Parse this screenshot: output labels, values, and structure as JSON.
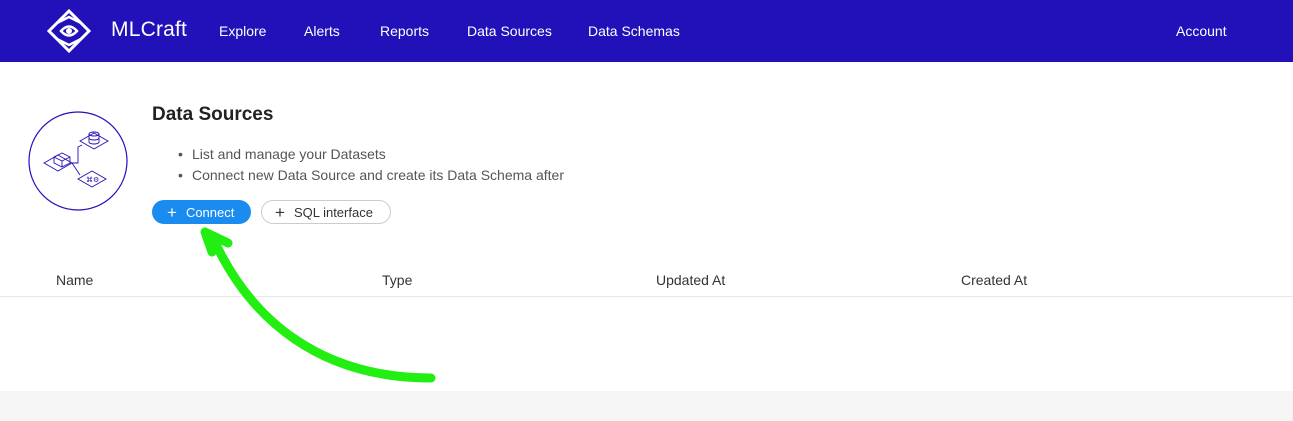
{
  "navbar": {
    "brand": "MLCraft",
    "items": [
      {
        "label": "Explore"
      },
      {
        "label": "Alerts"
      },
      {
        "label": "Reports"
      },
      {
        "label": "Data Sources"
      },
      {
        "label": "Data Schemas"
      }
    ],
    "account": "Account",
    "background_color": "#2210b8",
    "logo_icon": "diamond-eye-logo-icon"
  },
  "page": {
    "title": "Data Sources",
    "illustration_icon": "database-schema-illustration-icon",
    "bullets": [
      "List and manage your Datasets",
      "Connect new Data Source and create its Data Schema after"
    ],
    "buttons": {
      "connect": "Connect",
      "sql": "SQL interface"
    },
    "primary_color": "#1a8cf0"
  },
  "table": {
    "columns": [
      "Name",
      "Type",
      "Updated At",
      "Created At"
    ],
    "rows": []
  },
  "annotation": {
    "type": "arrow",
    "color": "#22ee11",
    "points_to": "connect-button"
  }
}
